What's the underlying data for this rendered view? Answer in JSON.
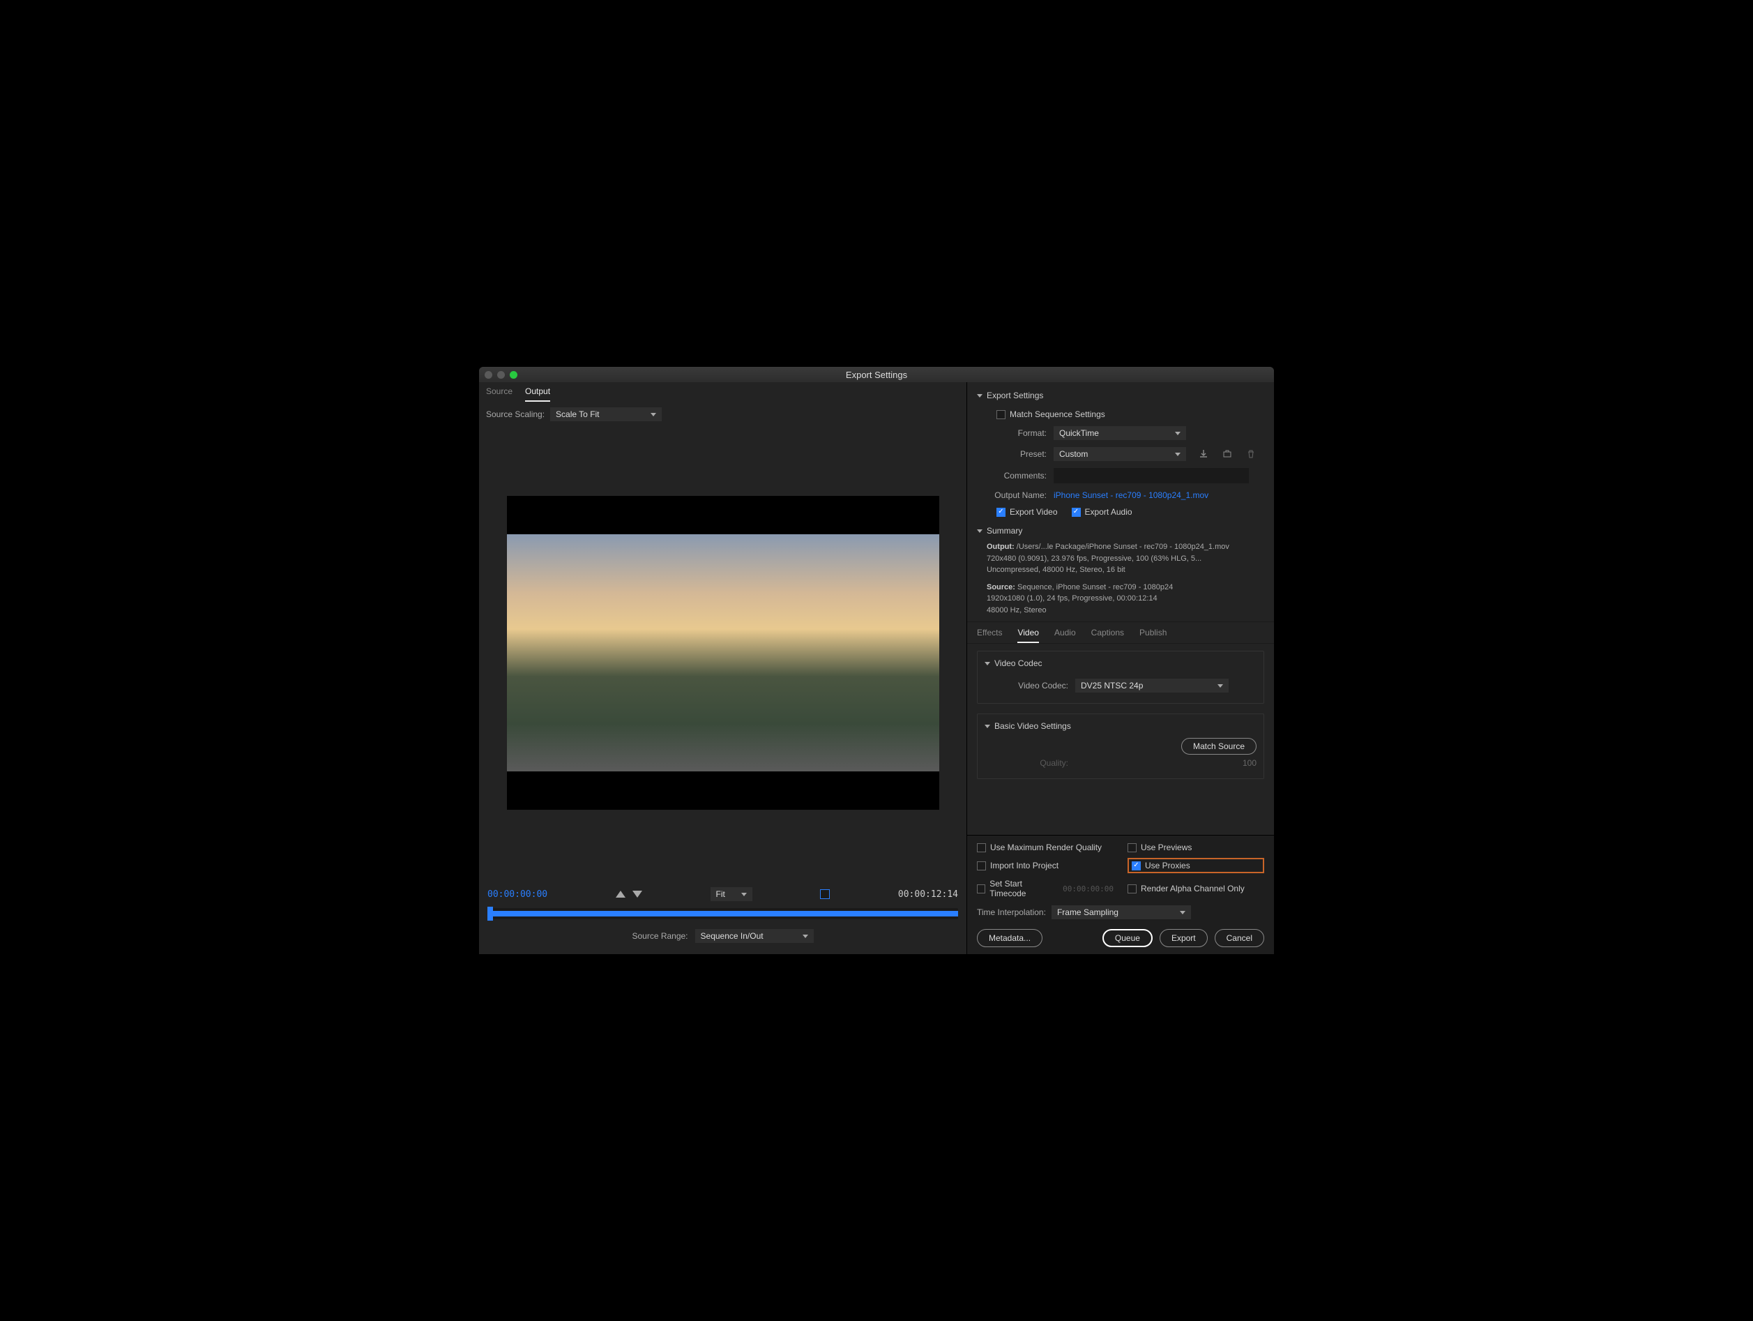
{
  "title": "Export Settings",
  "left_tabs": {
    "source": "Source",
    "output": "Output"
  },
  "source_scaling_label": "Source Scaling:",
  "source_scaling_value": "Scale To Fit",
  "time_start": "00:00:00:00",
  "time_end": "00:00:12:14",
  "fit_label": "Fit",
  "source_range_label": "Source Range:",
  "source_range_value": "Sequence In/Out",
  "export_settings_header": "Export Settings",
  "match_sequence_label": "Match Sequence Settings",
  "format_label": "Format:",
  "format_value": "QuickTime",
  "preset_label": "Preset:",
  "preset_value": "Custom",
  "comments_label": "Comments:",
  "output_name_label": "Output Name:",
  "output_name_value": "iPhone Sunset - rec709 - 1080p24_1.mov",
  "export_video_label": "Export Video",
  "export_audio_label": "Export Audio",
  "summary_label": "Summary",
  "summary_output_label": "Output:",
  "summary_output_line1": "/Users/...le Package/iPhone Sunset - rec709 - 1080p24_1.mov",
  "summary_output_line2": "720x480 (0.9091), 23.976 fps, Progressive, 100 (63% HLG, 5...",
  "summary_output_line3": "Uncompressed, 48000 Hz, Stereo, 16 bit",
  "summary_source_label": "Source:",
  "summary_source_line1": "Sequence, iPhone Sunset - rec709 - 1080p24",
  "summary_source_line2": "1920x1080 (1.0), 24 fps, Progressive, 00:00:12:14",
  "summary_source_line3": "48000 Hz, Stereo",
  "tabs2": {
    "effects": "Effects",
    "video": "Video",
    "audio": "Audio",
    "captions": "Captions",
    "publish": "Publish"
  },
  "video_codec_header": "Video Codec",
  "video_codec_label": "Video Codec:",
  "video_codec_value": "DV25 NTSC 24p",
  "basic_video_header": "Basic Video Settings",
  "match_source_btn": "Match Source",
  "quality_label": "Quality:",
  "quality_value": "100",
  "bottom": {
    "max_quality": "Use Maximum Render Quality",
    "use_previews": "Use Previews",
    "import_project": "Import Into Project",
    "use_proxies": "Use Proxies",
    "set_start_tc": "Set Start Timecode",
    "start_tc_value": "00:00:00:00",
    "render_alpha": "Render Alpha Channel Only",
    "time_interp_label": "Time Interpolation:",
    "time_interp_value": "Frame Sampling"
  },
  "buttons": {
    "metadata": "Metadata...",
    "queue": "Queue",
    "export": "Export",
    "cancel": "Cancel"
  }
}
